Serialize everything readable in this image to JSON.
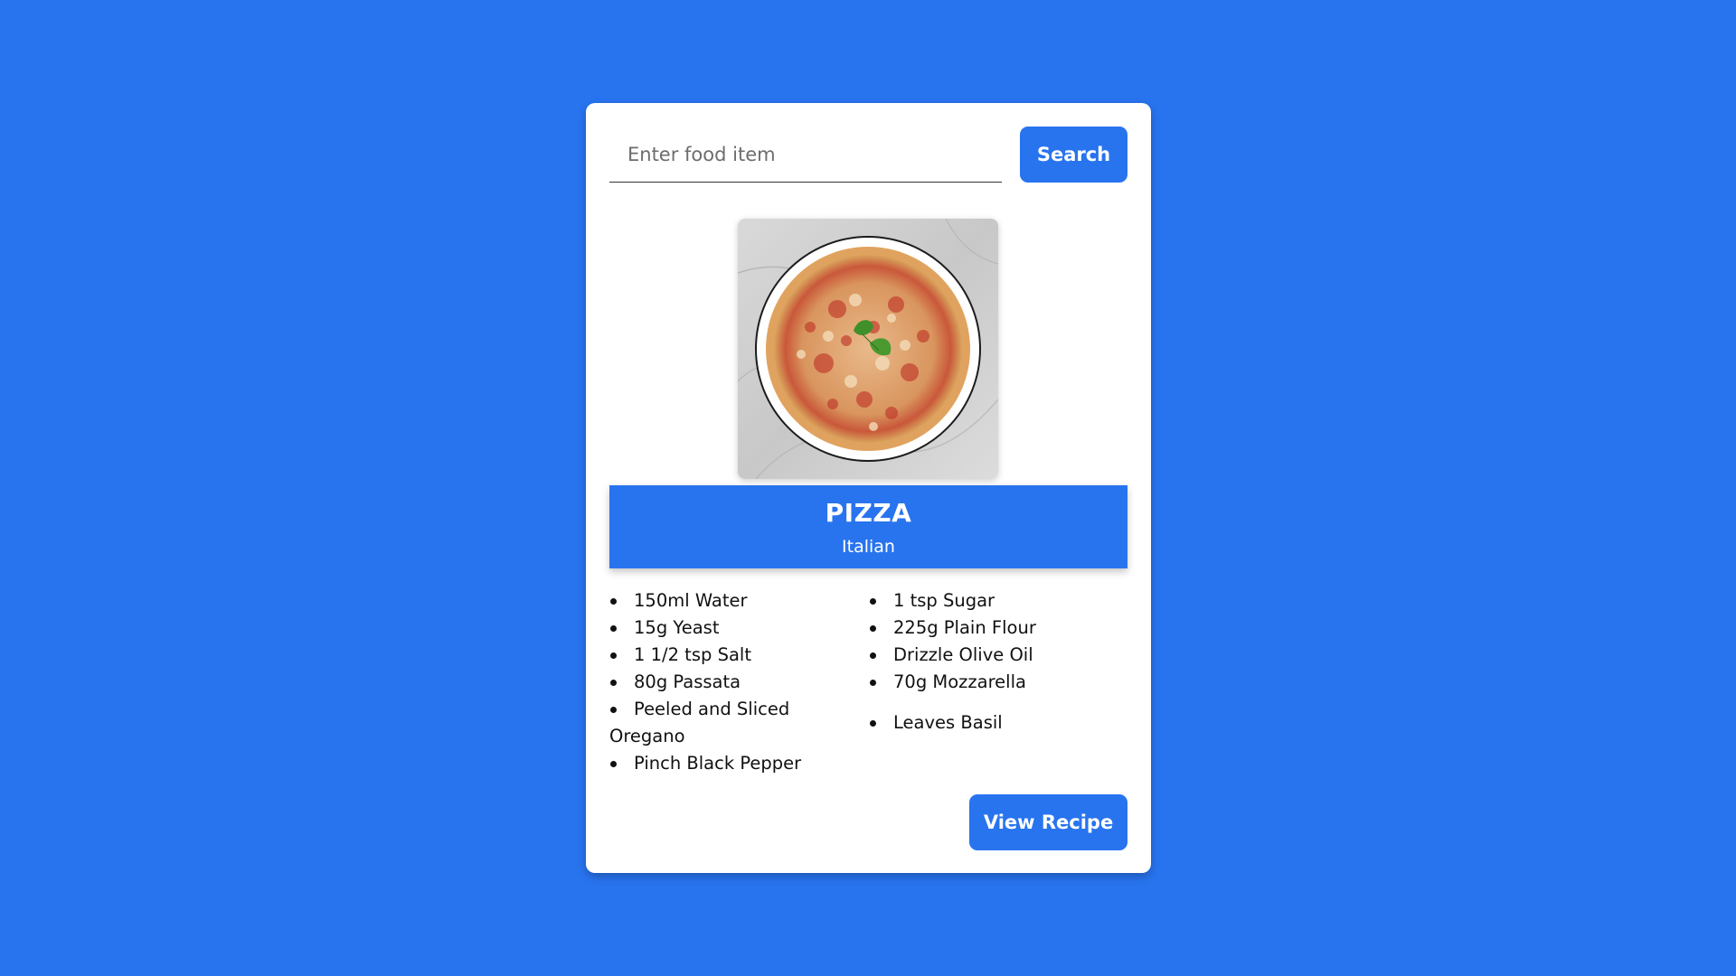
{
  "colors": {
    "background": "#2874ef",
    "accent": "#2874ef",
    "card": "#ffffff"
  },
  "search": {
    "placeholder": "Enter food item",
    "value": "",
    "button_label": "Search",
    "button_icon": "none"
  },
  "meal": {
    "image_icon": "pizza-photo",
    "name": "PIZZA",
    "cuisine": "Italian",
    "ingredients_left": [
      "150ml Water",
      "15g Yeast",
      "1 1/2 tsp Salt",
      "80g Passata",
      "Peeled and Sliced Oregano",
      "Pinch Black Pepper"
    ],
    "ingredients_right": [
      "1 tsp Sugar",
      "225g Plain Flour",
      "Drizzle Olive Oil",
      "70g Mozzarella",
      "Leaves Basil"
    ]
  },
  "actions": {
    "view_recipe_label": "View Recipe"
  }
}
